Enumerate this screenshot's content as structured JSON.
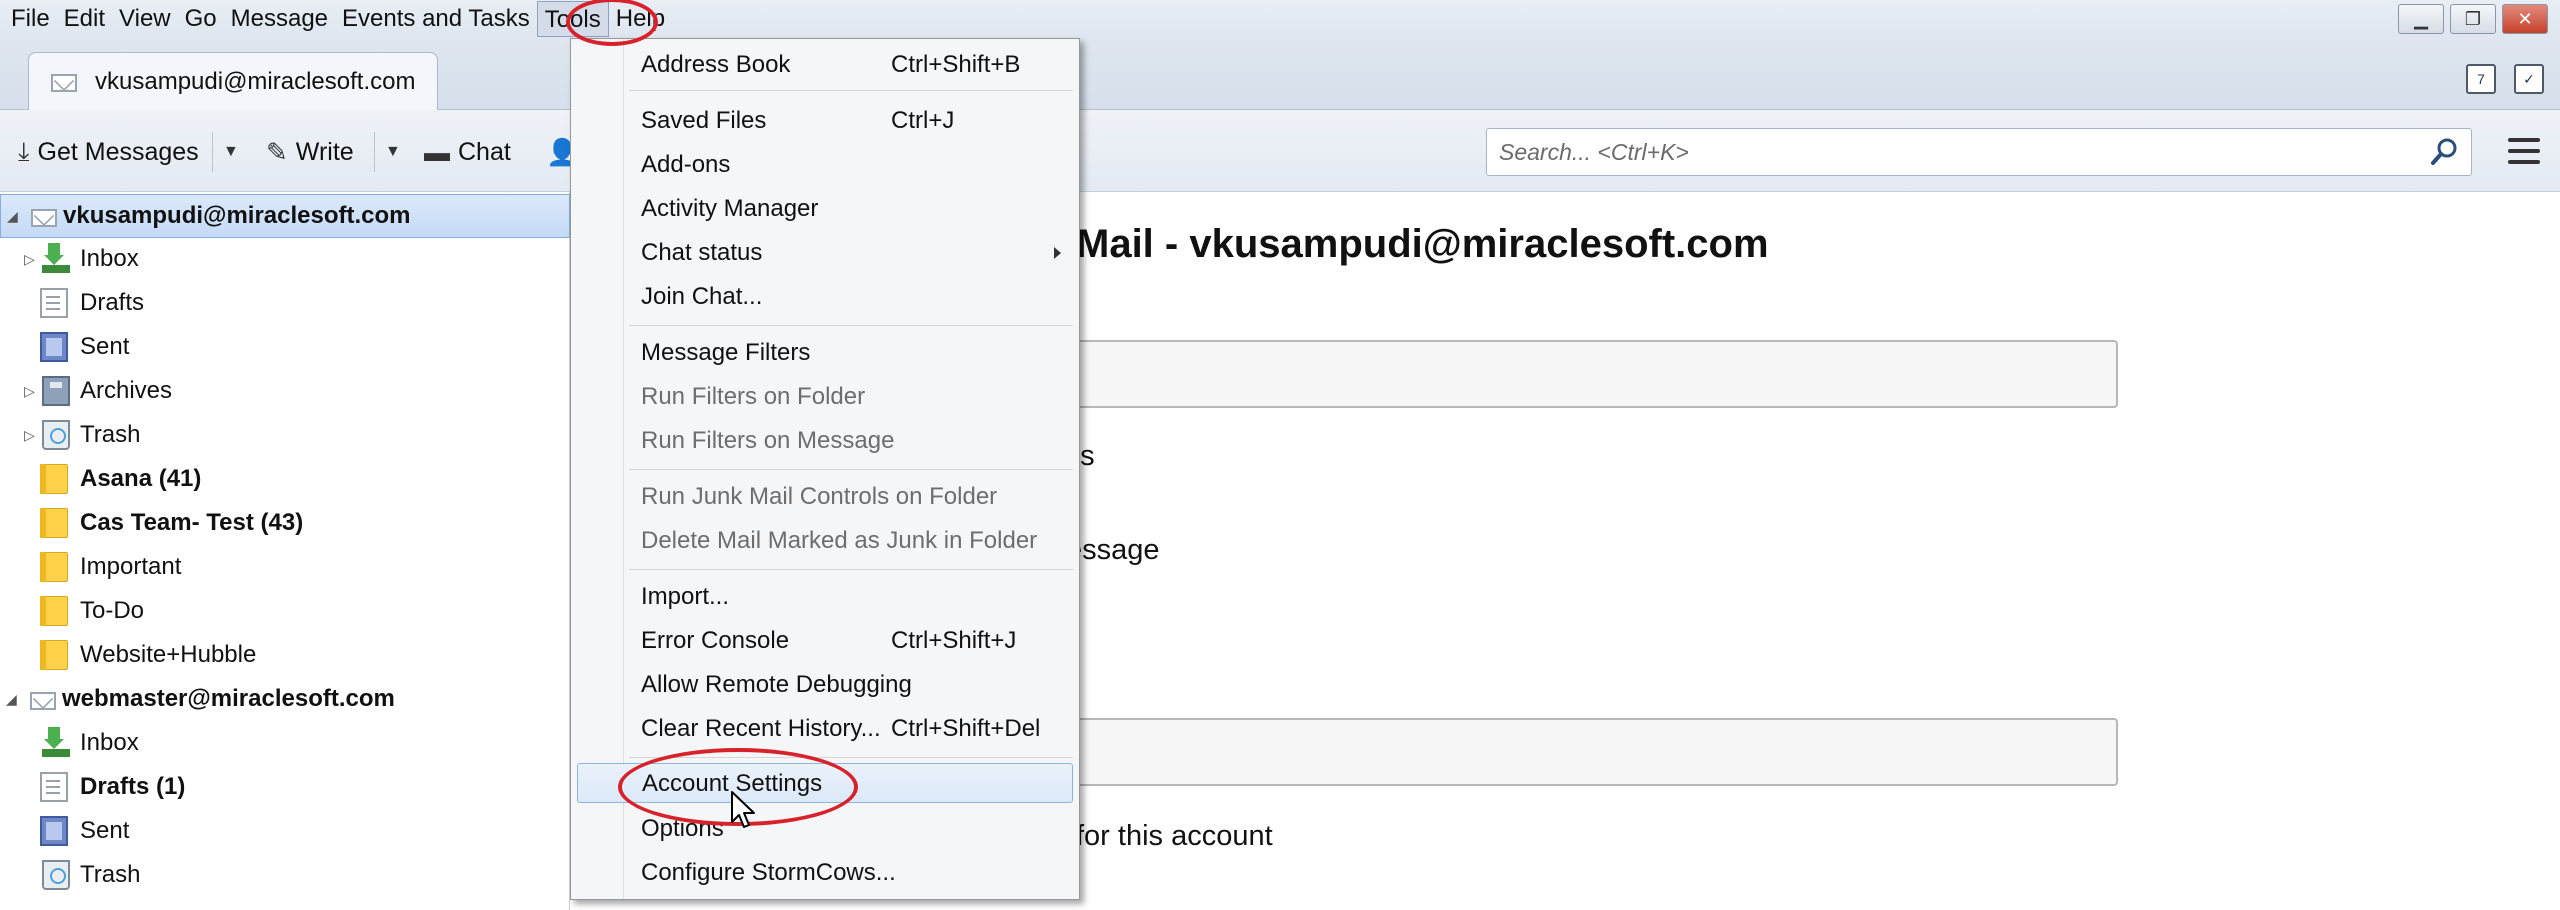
{
  "menubar": {
    "items": [
      {
        "label": "File"
      },
      {
        "label": "Edit"
      },
      {
        "label": "View"
      },
      {
        "label": "Go"
      },
      {
        "label": "Message"
      },
      {
        "label": "Events and Tasks"
      },
      {
        "label": "Tools"
      },
      {
        "label": "Help"
      }
    ]
  },
  "tab": {
    "label": "vkusampudi@miraclesoft.com"
  },
  "toolbar": {
    "get_messages": "Get Messages",
    "write": "Write",
    "chat": "Chat"
  },
  "search": {
    "placeholder": "Search... <Ctrl+K>"
  },
  "folders": [
    {
      "label": "vkusampudi@miraclesoft.com",
      "bold": true,
      "type": "account"
    },
    {
      "label": "Inbox",
      "type": "inbox"
    },
    {
      "label": "Drafts",
      "type": "doc"
    },
    {
      "label": "Sent",
      "type": "sent"
    },
    {
      "label": "Archives",
      "type": "archive"
    },
    {
      "label": "Trash",
      "type": "trash"
    },
    {
      "label": "Asana (41)",
      "bold": true,
      "type": "folder"
    },
    {
      "label": "Cas Team- Test (43)",
      "bold": true,
      "type": "folder"
    },
    {
      "label": "Important",
      "type": "folder"
    },
    {
      "label": "To-Do",
      "type": "folder"
    },
    {
      "label": "Website+Hubble",
      "type": "folder"
    },
    {
      "label": "webmaster@miraclesoft.com",
      "bold": true,
      "type": "account"
    },
    {
      "label": "Inbox",
      "type": "inbox"
    },
    {
      "label": "Drafts (1)",
      "bold": true,
      "type": "doc"
    },
    {
      "label": "Sent",
      "type": "sent"
    },
    {
      "label": "Trash",
      "type": "trash"
    }
  ],
  "content": {
    "title": "Mail - vkusampudi@miraclesoft.com",
    "text1": "es",
    "text2": "essage",
    "text3": "for this account"
  },
  "tools_menu": {
    "items": [
      {
        "label": "Address Book",
        "shortcut": "Ctrl+Shift+B"
      },
      {
        "label": "Saved Files",
        "shortcut": "Ctrl+J"
      },
      {
        "label": "Add-ons",
        "shortcut": ""
      },
      {
        "label": "Activity Manager",
        "shortcut": ""
      },
      {
        "label": "Chat status",
        "shortcut": ""
      },
      {
        "label": "Join Chat...",
        "shortcut": ""
      },
      {
        "label": "Message Filters",
        "shortcut": ""
      },
      {
        "label": "Run Filters on Folder",
        "shortcut": ""
      },
      {
        "label": "Run Filters on Message",
        "shortcut": ""
      },
      {
        "label": "Run Junk Mail Controls on Folder",
        "shortcut": ""
      },
      {
        "label": "Delete Mail Marked as Junk in Folder",
        "shortcut": ""
      },
      {
        "label": "Import...",
        "shortcut": ""
      },
      {
        "label": "Error Console",
        "shortcut": "Ctrl+Shift+J"
      },
      {
        "label": "Allow Remote Debugging",
        "shortcut": ""
      },
      {
        "label": "Clear Recent History...",
        "shortcut": "Ctrl+Shift+Del"
      },
      {
        "label": "Account Settings",
        "shortcut": ""
      },
      {
        "label": "Options",
        "shortcut": ""
      },
      {
        "label": "Configure StormCows...",
        "shortcut": ""
      }
    ]
  },
  "colors": {
    "annotation_red": "#d8222b",
    "selection_blue": "#c4daf6",
    "folder_yellow": "#ffd24a"
  }
}
